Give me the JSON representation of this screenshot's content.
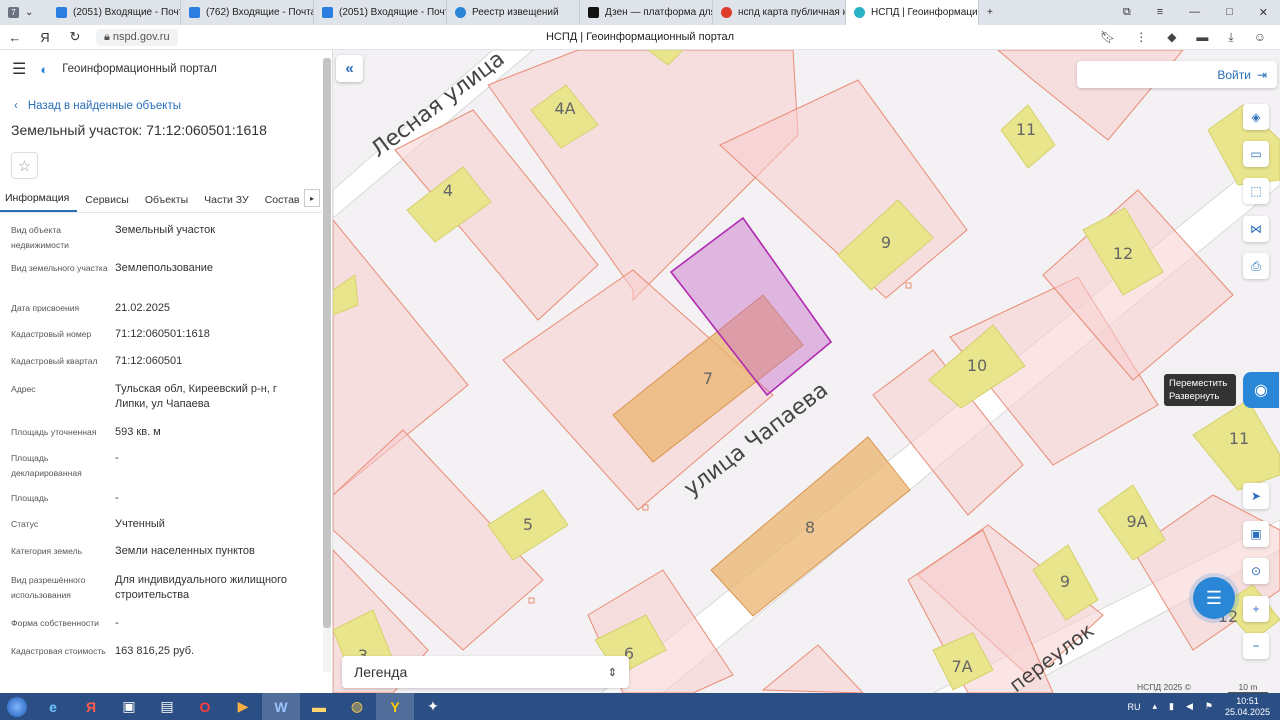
{
  "browser": {
    "tabs": [
      {
        "label": "(2051) Входящие - Почта",
        "color": "#2a7de1"
      },
      {
        "label": "(762) Входящие - Почта",
        "color": "#2a7de1"
      },
      {
        "label": "(2051) Входящие - Почта",
        "color": "#2a7de1"
      },
      {
        "label": "Реестр извещений",
        "color": "#2a86d6"
      },
      {
        "label": "Дзен — платформа для п",
        "color": "#111111"
      },
      {
        "label": "нспд карта публичная кар",
        "color": "#e03c2c"
      },
      {
        "label": "НСПД | Геоинформацио",
        "color": "#2ab3c7"
      }
    ],
    "tab_counter": "7",
    "url": "nspd.gov.ru",
    "page_title": "НСПД | Геоинформационный портал"
  },
  "panel": {
    "portal_name": "Геоинформационный портал",
    "back_label": "Назад в найденные объекты",
    "title": "Земельный участок: 71:12:060501:1618",
    "tabs": [
      "Информация",
      "Сервисы",
      "Объекты",
      "Части ЗУ",
      "Состав"
    ],
    "props": [
      {
        "k": "Вид объекта недвижимости",
        "v": "Земельный участок"
      },
      {
        "k": "Вид земельного участка",
        "v": "Землепользование"
      },
      {
        "k": "Дата присвоения",
        "v": "21.02.2025"
      },
      {
        "k": "Кадастровый номер",
        "v": "71:12:060501:1618"
      },
      {
        "k": "Кадастровый квартал",
        "v": "71:12:060501"
      },
      {
        "k": "Адрес",
        "v": "Тульская обл, Киреевский р-н, г Липки, ул Чапаева"
      },
      {
        "k": "Площадь уточненная",
        "v": "593 кв. м"
      },
      {
        "k": "Площадь декларированная",
        "v": "-"
      },
      {
        "k": "Площадь",
        "v": "-"
      },
      {
        "k": "Статус",
        "v": "Учтенный"
      },
      {
        "k": "Категория земель",
        "v": "Земли населенных пунктов"
      },
      {
        "k": "Вид разрешённого использования",
        "v": "Для индивидуального жилищного строительства"
      },
      {
        "k": "Форма собственности",
        "v": "-"
      },
      {
        "k": "Кадастровая стоимость",
        "v": "163 816,25 руб."
      }
    ]
  },
  "map": {
    "login_label": "Войти",
    "streets": [
      "Лесная улица",
      "улица Чапаева",
      "переулок"
    ],
    "house_numbers": [
      "4А",
      "4",
      "11",
      "9",
      "12",
      "7",
      "10",
      "11",
      "5",
      "8",
      "9А",
      "9",
      "3",
      "6",
      "7А",
      "12"
    ],
    "tooltip_line1": "Переместить",
    "tooltip_line2": "Развернуть",
    "legend_label": "Легенда",
    "copyright": "НСПД 2025 ©",
    "scale_label": "10 m"
  },
  "taskbar": {
    "lang": "RU",
    "time": "10:51",
    "date": "25.04.2025"
  }
}
